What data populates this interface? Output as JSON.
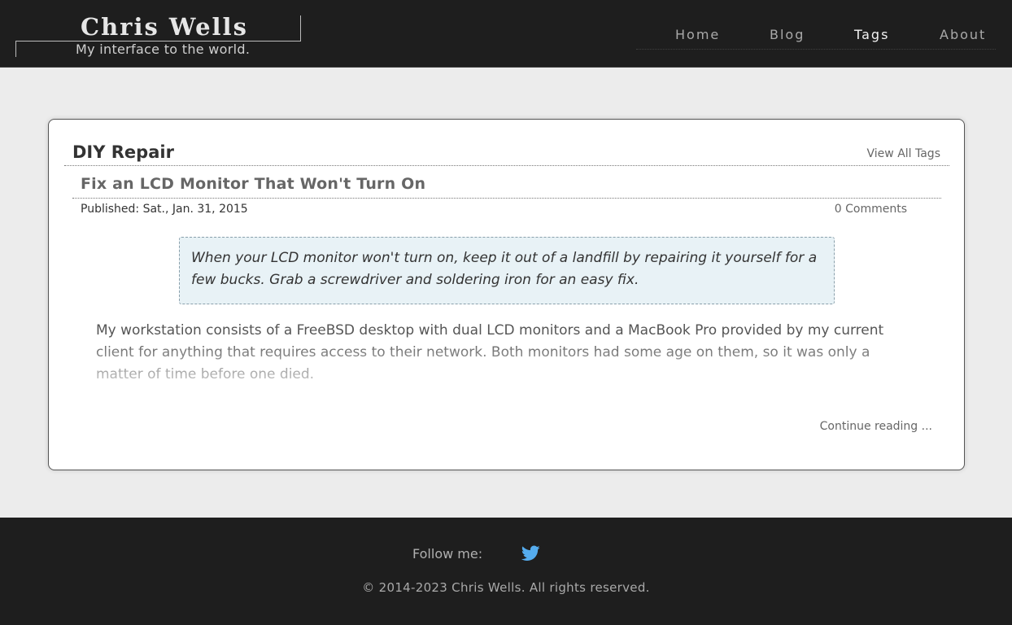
{
  "header": {
    "site_title": "Chris Wells",
    "tagline": "My interface to the world."
  },
  "nav": {
    "items": [
      {
        "label": "Home",
        "active": false
      },
      {
        "label": "Blog",
        "active": false
      },
      {
        "label": "Tags",
        "active": true
      },
      {
        "label": "About",
        "active": false
      }
    ]
  },
  "tag_page": {
    "title": "DIY Repair",
    "view_all_label": "View All Tags"
  },
  "post": {
    "title": "Fix an LCD Monitor That Won't Turn On",
    "published": "Published: Sat., Jan. 31, 2015",
    "comments": "0 Comments",
    "summary": "When your LCD monitor won't turn on, keep it out of a landfill by repairing it yourself for a few bucks. Grab a screwdriver and soldering iron for an easy fix.",
    "excerpt": "My workstation consists of a FreeBSD desktop with dual LCD monitors and a MacBook Pro provided by my current client for anything that requires access to their network. Both monitors had some age on them, so it was only a matter of time before one died.",
    "continue_label": "Continue reading ..."
  },
  "footer": {
    "follow_label": "Follow me:",
    "twitter_icon": "twitter-bird-icon",
    "twitter_color": "#55acee",
    "copyright": "© 2014-2023 Chris Wells. All rights reserved."
  },
  "colors": {
    "header_bg": "#1e1e1e",
    "page_bg": "#ececec",
    "summary_bg": "#e8f2f6"
  }
}
